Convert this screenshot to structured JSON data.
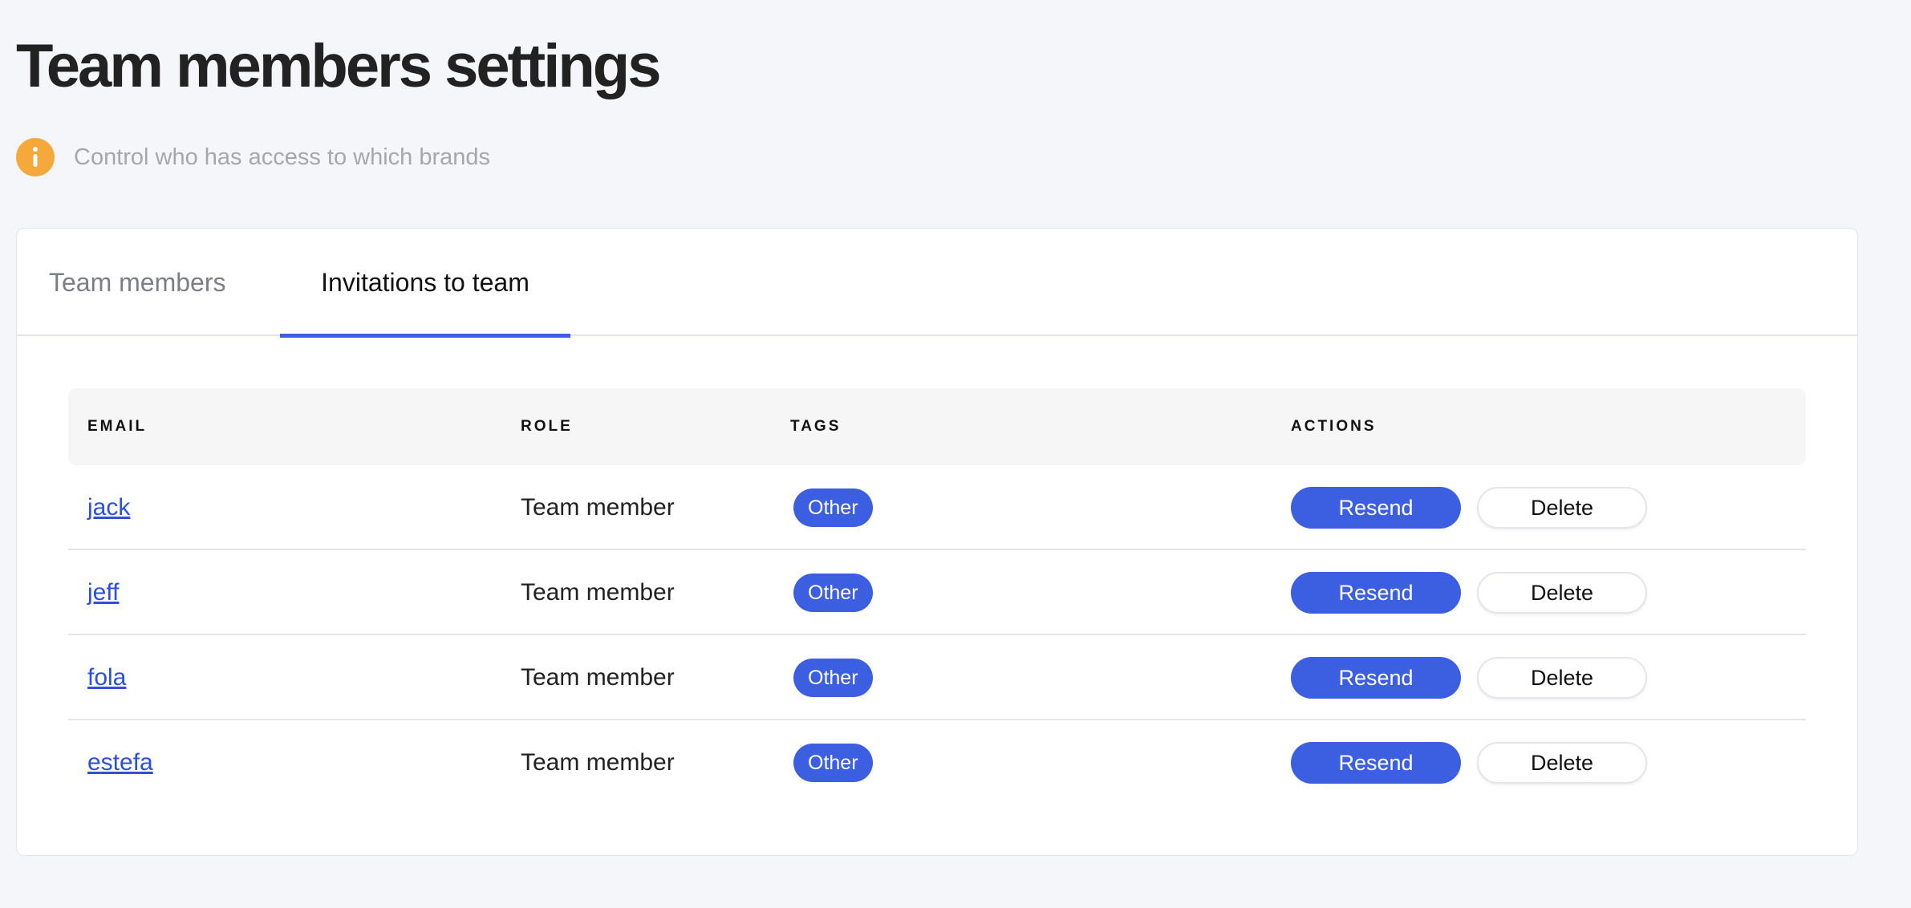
{
  "page": {
    "title": "Team members settings",
    "subtitle": "Control who has access to which brands",
    "info_icon": "info-icon"
  },
  "tabs": [
    {
      "label": "Team members",
      "active": false
    },
    {
      "label": "Invitations to team",
      "active": true
    }
  ],
  "table": {
    "headers": {
      "email": "EMAIL",
      "role": "ROLE",
      "tags": "TAGS",
      "actions": "ACTIONS"
    },
    "rows": [
      {
        "email": "jack",
        "role": "Team member",
        "tag": "Other",
        "resend_label": "Resend",
        "delete_label": "Delete"
      },
      {
        "email": "jeff",
        "role": "Team member",
        "tag": "Other",
        "resend_label": "Resend",
        "delete_label": "Delete"
      },
      {
        "email": "fola",
        "role": "Team member",
        "tag": "Other",
        "resend_label": "Resend",
        "delete_label": "Delete"
      },
      {
        "email": "estefa",
        "role": "Team member",
        "tag": "Other",
        "resend_label": "Resend",
        "delete_label": "Delete"
      }
    ]
  },
  "colors": {
    "accent": "#3b5fe0",
    "link": "#2d4fe0",
    "info": "#f5a93a",
    "background": "#f5f6fa"
  }
}
